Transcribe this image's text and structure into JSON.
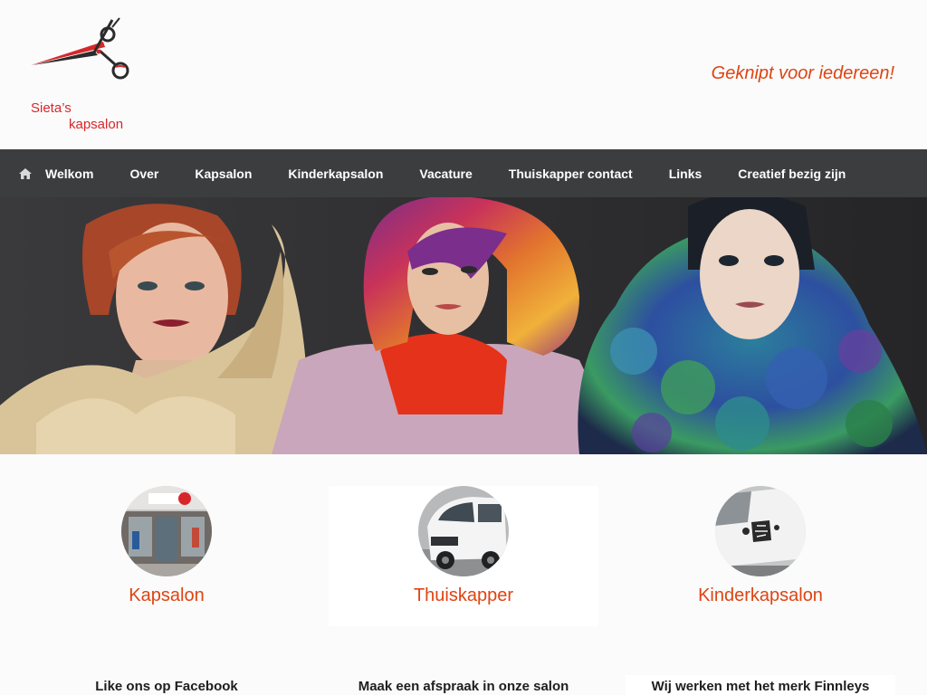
{
  "header": {
    "logo_line1": "Sieta’s",
    "logo_line2": "kapsalon",
    "tagline": "Geknipt voor iedereen!"
  },
  "nav": {
    "items": [
      {
        "label": "Welkom",
        "icon": "home-icon"
      },
      {
        "label": "Over"
      },
      {
        "label": "Kapsalon"
      },
      {
        "label": "Kinderkapsalon"
      },
      {
        "label": "Vacature"
      },
      {
        "label": "Thuiskapper contact"
      },
      {
        "label": "Links"
      },
      {
        "label": "Creatief bezig zijn"
      }
    ]
  },
  "features": [
    {
      "label": "Kapsalon",
      "image": "salon-storefront-photo"
    },
    {
      "label": "Thuiskapper",
      "image": "white-van-photo"
    },
    {
      "label": "Kinderkapsalon",
      "image": "van-decal-photo"
    }
  ],
  "bottom": {
    "headings": [
      "Like ons op Facebook",
      "Maak een afspraak in onze salon",
      "Wij werken met het merk Finnleys"
    ]
  },
  "colors": {
    "accent": "#de4412",
    "logo_red": "#d7262b",
    "nav_bg": "#3c3d3f"
  }
}
